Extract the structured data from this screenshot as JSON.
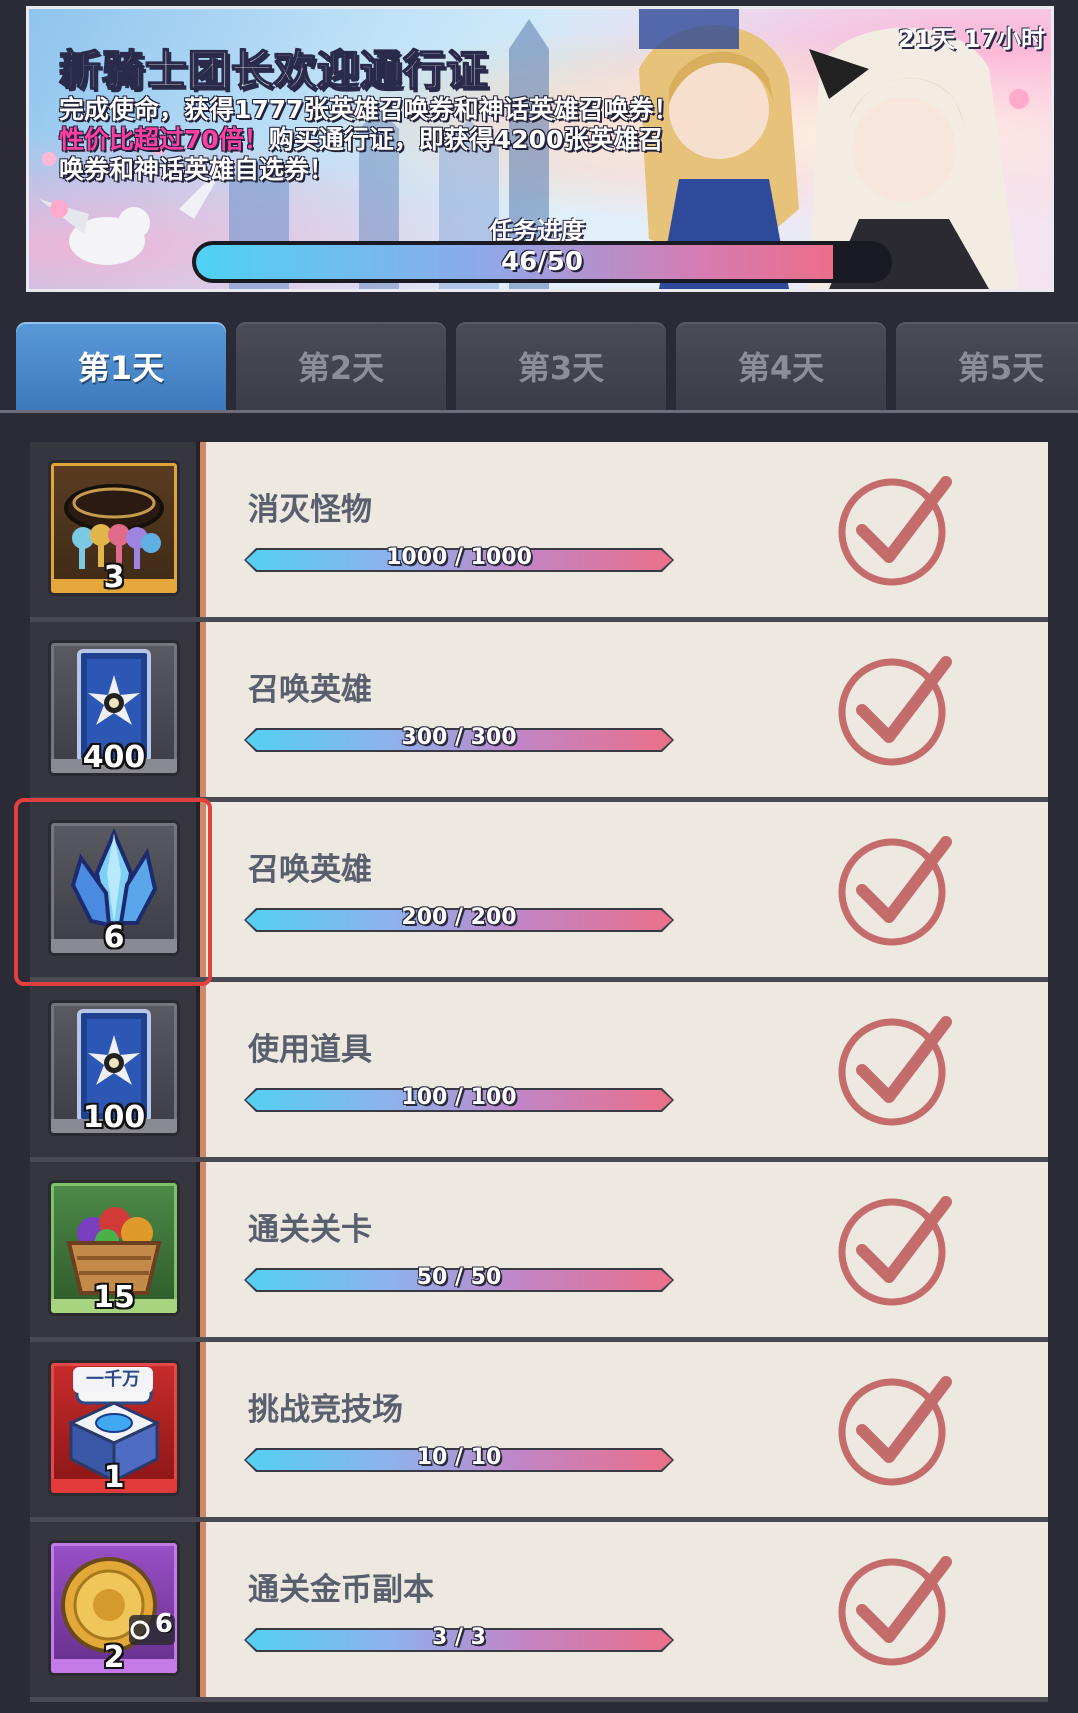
{
  "banner": {
    "title": "新骑士团长欢迎通行证",
    "desc_line1": "完成使命，获得1777张英雄召唤券和神话英雄召唤券！",
    "desc_highlight": "性价比超过70倍！",
    "desc_line2": "购买通行证，即获得4200张英雄召",
    "desc_line3": "唤券和神话英雄自选券！",
    "timer": "21天 17小时",
    "progress_label": "任务进度",
    "progress_text": "46/50",
    "progress_value": 0.92
  },
  "tabs": [
    "第1天",
    "第2天",
    "第3天",
    "第4天",
    "第5天"
  ],
  "active_tab": 0,
  "missions": [
    {
      "name": "消灭怪物",
      "progress": "1000 / 1000",
      "reward_qty": "3",
      "reward_icon": "key-bundle-icon",
      "tile": "gold"
    },
    {
      "name": "召唤英雄",
      "progress": "300 / 300",
      "reward_qty": "400",
      "reward_icon": "summon-ticket-icon",
      "tile": "grey"
    },
    {
      "name": "召唤英雄",
      "progress": "200 / 200",
      "reward_qty": "6",
      "reward_icon": "crystal-icon",
      "tile": "grey"
    },
    {
      "name": "使用道具",
      "progress": "100 / 100",
      "reward_qty": "100",
      "reward_icon": "summon-ticket-icon",
      "tile": "grey"
    },
    {
      "name": "通关关卡",
      "progress": "50 / 50",
      "reward_qty": "15",
      "reward_icon": "fruit-basket-icon",
      "tile": "green"
    },
    {
      "name": "挑战竞技场",
      "progress": "10 / 10",
      "reward_qty": "1",
      "reward_icon": "gem-box-icon",
      "reward_badge": "一千万",
      "tile": "red"
    },
    {
      "name": "通关金币副本",
      "progress": "3 / 3",
      "reward_qty": "2",
      "reward_icon": "gold-coin-icon",
      "reward_timer": "6",
      "tile": "purple"
    }
  ],
  "colors": {
    "active_tab": "#4a8ad0",
    "check": "#c46b6b",
    "highlight_border": "#e23f3f",
    "row_bg": "#ede9e1"
  }
}
